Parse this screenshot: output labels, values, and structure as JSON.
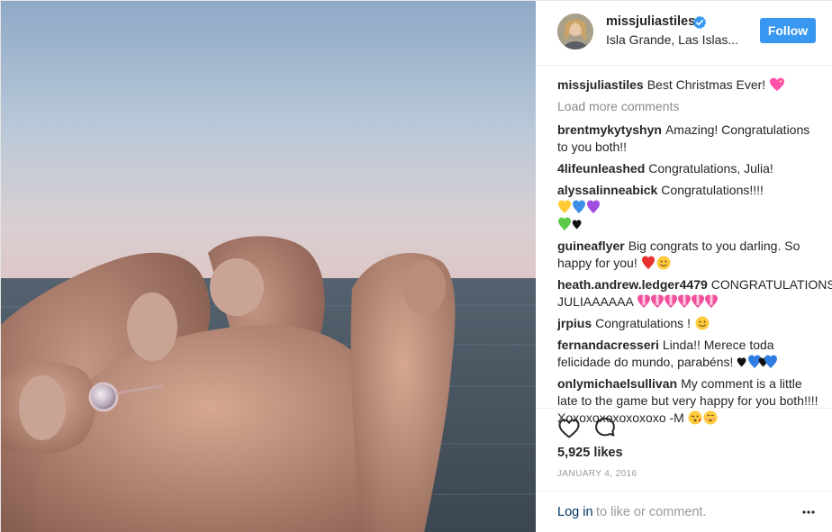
{
  "post": {
    "photo_alt": "",
    "header": {
      "username": "missjuliastiles",
      "verified_icon": "verified-badge-icon",
      "location": "Isla Grande, Las Islas...",
      "follow_label": "Follow"
    },
    "caption": {
      "author": "missjuliastiles",
      "text": "Best Christmas Ever!"
    },
    "load_more": "Load more comments",
    "comments": [
      {
        "author": "brentmykytyshyn",
        "text": "Amazing! Congratulations to you both!!"
      },
      {
        "author": "4lifeunleashed",
        "text": "Congratulations, Julia!"
      },
      {
        "author": "alyssalinneabick",
        "text": "Congratulations!!!!"
      },
      {
        "author": "guineaflyer",
        "text": "Big congrats to you darling. So happy for you!"
      },
      {
        "author": "heath.andrew.ledger4479",
        "text": "CONGRATULATIONS JULIAAAAAA"
      },
      {
        "author": "jrpius",
        "text": "Congratulations !"
      },
      {
        "author": "fernandacresseri",
        "text": "Linda!! Merece toda felicidade do mundo, parabéns!"
      },
      {
        "author": "onlymichaelsullivan",
        "text": "My comment is a little late to the game but very happy for you both!!!! Xoxoxoxoxoxoxoxo -M"
      }
    ],
    "likes": "5,925 likes",
    "date": "JANUARY 4, 2016",
    "footer": {
      "login_label": "Log in",
      "login_rest": "to like or comment."
    },
    "icons": {
      "like": "heart-outline-icon",
      "comment": "speech-bubble-icon",
      "more": "more-options-icon"
    },
    "colors": {
      "follow_button": "#3897f0",
      "link": "#003569",
      "muted": "#999999"
    }
  }
}
